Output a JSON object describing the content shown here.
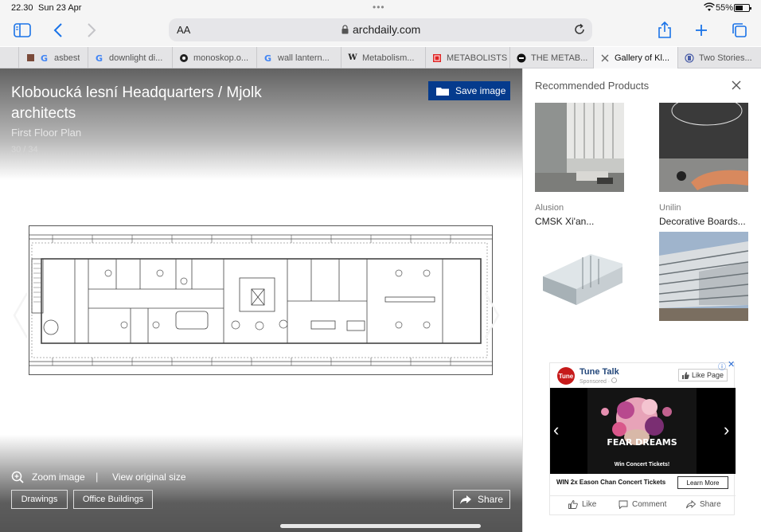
{
  "status_bar": {
    "time": "22.30",
    "date": "Sun 23 Apr",
    "battery": "55%"
  },
  "toolbar": {
    "text_size_label": "AA",
    "url": "archdaily.com"
  },
  "tabs": [
    {
      "label": "asbest",
      "favicon": "book-icon",
      "active": false
    },
    {
      "label": "downlight di...",
      "favicon": "google-icon",
      "active": false
    },
    {
      "label": "monoskop.o...",
      "favicon": "monoskop-icon",
      "active": false
    },
    {
      "label": "wall lantern...",
      "favicon": "google-icon",
      "active": false
    },
    {
      "label": "Metabolism...",
      "favicon": "wikipedia-icon",
      "active": false
    },
    {
      "label": "METABOLISTS",
      "favicon": "pdf-icon",
      "active": false
    },
    {
      "label": "THE METAB...",
      "favicon": "circle-icon",
      "active": false
    },
    {
      "label": "Gallery of Kl...",
      "favicon": "close-icon",
      "active": true
    },
    {
      "label": "Two Stories...",
      "favicon": "page-icon",
      "active": false
    }
  ],
  "gallery": {
    "title": "Kloboucká lesní Headquarters / Mjolk architects",
    "subtitle": "First Floor Plan",
    "counter": "30 / 34",
    "save_label": "Save image",
    "zoom_label": "Zoom image",
    "separator": "|",
    "original_label": "View original size",
    "tags": [
      "Drawings",
      "Office Buildings"
    ],
    "share_label": "Share"
  },
  "sidebar": {
    "title": "Recommended Products",
    "products": [
      {
        "brand": "Alusion",
        "name": "CMSK Xi'an..."
      },
      {
        "brand": "Unilin",
        "name": "Decorative Boards..."
      },
      {
        "brand": "",
        "name": ""
      },
      {
        "brand": "",
        "name": ""
      }
    ]
  },
  "ad": {
    "advertiser": "Tune Talk",
    "sponsored": "Sponsored · ",
    "logo_text": "Tune",
    "like_page": "Like Page",
    "poster_title": "FEAR DREAMS",
    "poster_tagline": "Win Concert Tickets!",
    "caption": "WIN 2x Eason Chan Concert Tickets",
    "cta": "Learn More",
    "actions": [
      "Like",
      "Comment",
      "Share"
    ]
  },
  "colors": {
    "accent": "#1a73e8",
    "save_button": "#053b8d",
    "ad_logo": "#c61a1a"
  }
}
